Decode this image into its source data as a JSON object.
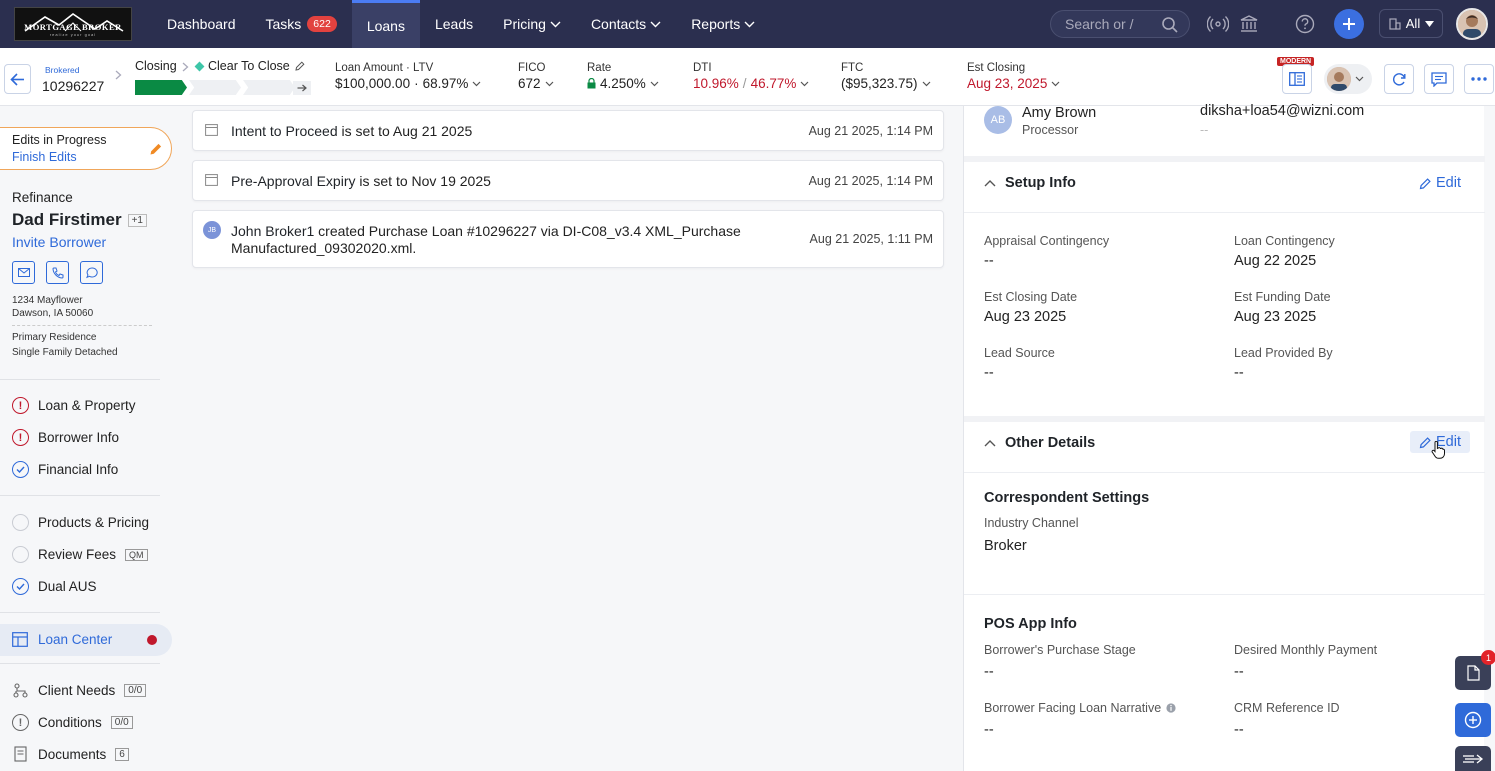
{
  "nav": {
    "logo_title": "MORTGAGE BROKER",
    "logo_tagline": "realize your goal",
    "items": [
      {
        "label": "Dashboard"
      },
      {
        "label": "Tasks",
        "badge": "622"
      },
      {
        "label": "Loans"
      },
      {
        "label": "Leads"
      },
      {
        "label": "Pricing"
      },
      {
        "label": "Contacts"
      },
      {
        "label": "Reports"
      }
    ],
    "search_placeholder": "Search or /",
    "scope_label": "All"
  },
  "loan_header": {
    "channel": "Brokered",
    "loan_number": "10296227",
    "stage": "Closing",
    "status": "Clear To Close",
    "metrics": {
      "loan_amount_label": "Loan Amount",
      "ltv_label": "LTV",
      "loan_amount": "$100,000.00",
      "ltv": "68.97%",
      "fico_label": "FICO",
      "fico": "672",
      "rate_label": "Rate",
      "rate": "4.250%",
      "dti_label": "DTI",
      "dti_front": "10.96%",
      "dti_back": "46.77%",
      "ftc_label": "FTC",
      "ftc": "($95,323.75)",
      "est_closing_label": "Est Closing",
      "est_closing": "Aug 23, 2025"
    },
    "view_badge": "MODERN"
  },
  "sidebar": {
    "edits_title": "Edits in Progress",
    "edits_link": "Finish Edits",
    "loan_purpose": "Refinance",
    "borrower_name": "Dad Firstimer",
    "co_borrower_count": "+1",
    "invite_label": "Invite Borrower",
    "address_line1": "1234 Mayflower",
    "address_line2": "Dawson, IA 50060",
    "occupancy": "Primary Residence",
    "property_type": "Single Family Detached",
    "group1": [
      {
        "label": "Loan & Property"
      },
      {
        "label": "Borrower Info"
      },
      {
        "label": "Financial Info"
      }
    ],
    "group2": [
      {
        "label": "Products & Pricing"
      },
      {
        "label": "Review Fees",
        "tag": "QM"
      },
      {
        "label": "Dual AUS"
      }
    ],
    "loan_center": "Loan Center",
    "group3": [
      {
        "label": "Client Needs",
        "count": "0/0"
      },
      {
        "label": "Conditions",
        "count": "0/0"
      },
      {
        "label": "Documents",
        "count": "6"
      }
    ]
  },
  "activity": [
    {
      "subject": "Intent to Proceed",
      "text": " is set to Aug 21 2025",
      "time": "Aug 21 2025, 1:14 PM"
    },
    {
      "subject": "Pre-Approval Expiry",
      "text": " is set to Nov 19 2025",
      "time": "Aug 21 2025, 1:14 PM"
    },
    {
      "initials": "JB",
      "subject": "John Broker1",
      "text": " created Purchase Loan #10296227 via DI-C08_v3.4 XML_Purchase",
      "text2": "Manufactured_09302020.xml.",
      "time": "Aug 21 2025, 1:11 PM"
    }
  ],
  "right_panel": {
    "contact": {
      "initials": "AB",
      "name": "Amy Brown",
      "role": "Processor",
      "email": "diksha+loa54@wizni.com",
      "phone": "--"
    },
    "setup": {
      "title": "Setup Info",
      "edit": "Edit",
      "fields": [
        {
          "label": "Appraisal Contingency",
          "value": "--"
        },
        {
          "label": "Loan Contingency",
          "value": "Aug 22 2025"
        },
        {
          "label": "Est Closing Date",
          "value": "Aug 23 2025"
        },
        {
          "label": "Est Funding Date",
          "value": "Aug 23 2025"
        },
        {
          "label": "Lead Source",
          "value": "--"
        },
        {
          "label": "Lead Provided By",
          "value": "--"
        }
      ]
    },
    "other": {
      "title": "Other Details",
      "edit": "Edit",
      "correspondent_title": "Correspondent Settings",
      "industry_channel_label": "Industry Channel",
      "industry_channel": "Broker",
      "pos_title": "POS App Info",
      "fields": [
        {
          "label": "Borrower's Purchase Stage",
          "value": "--"
        },
        {
          "label": "Desired Monthly Payment",
          "value": "--"
        },
        {
          "label": "Borrower Facing Loan Narrative",
          "value": "--"
        },
        {
          "label": "CRM Reference ID",
          "value": "--"
        }
      ]
    }
  },
  "floating": {
    "notification_count": "1"
  },
  "colors": {
    "nav_bg": "#2b2f4f",
    "accent": "#2f6ad9",
    "alert": "#c0182c",
    "progress": "#0a8a44"
  }
}
